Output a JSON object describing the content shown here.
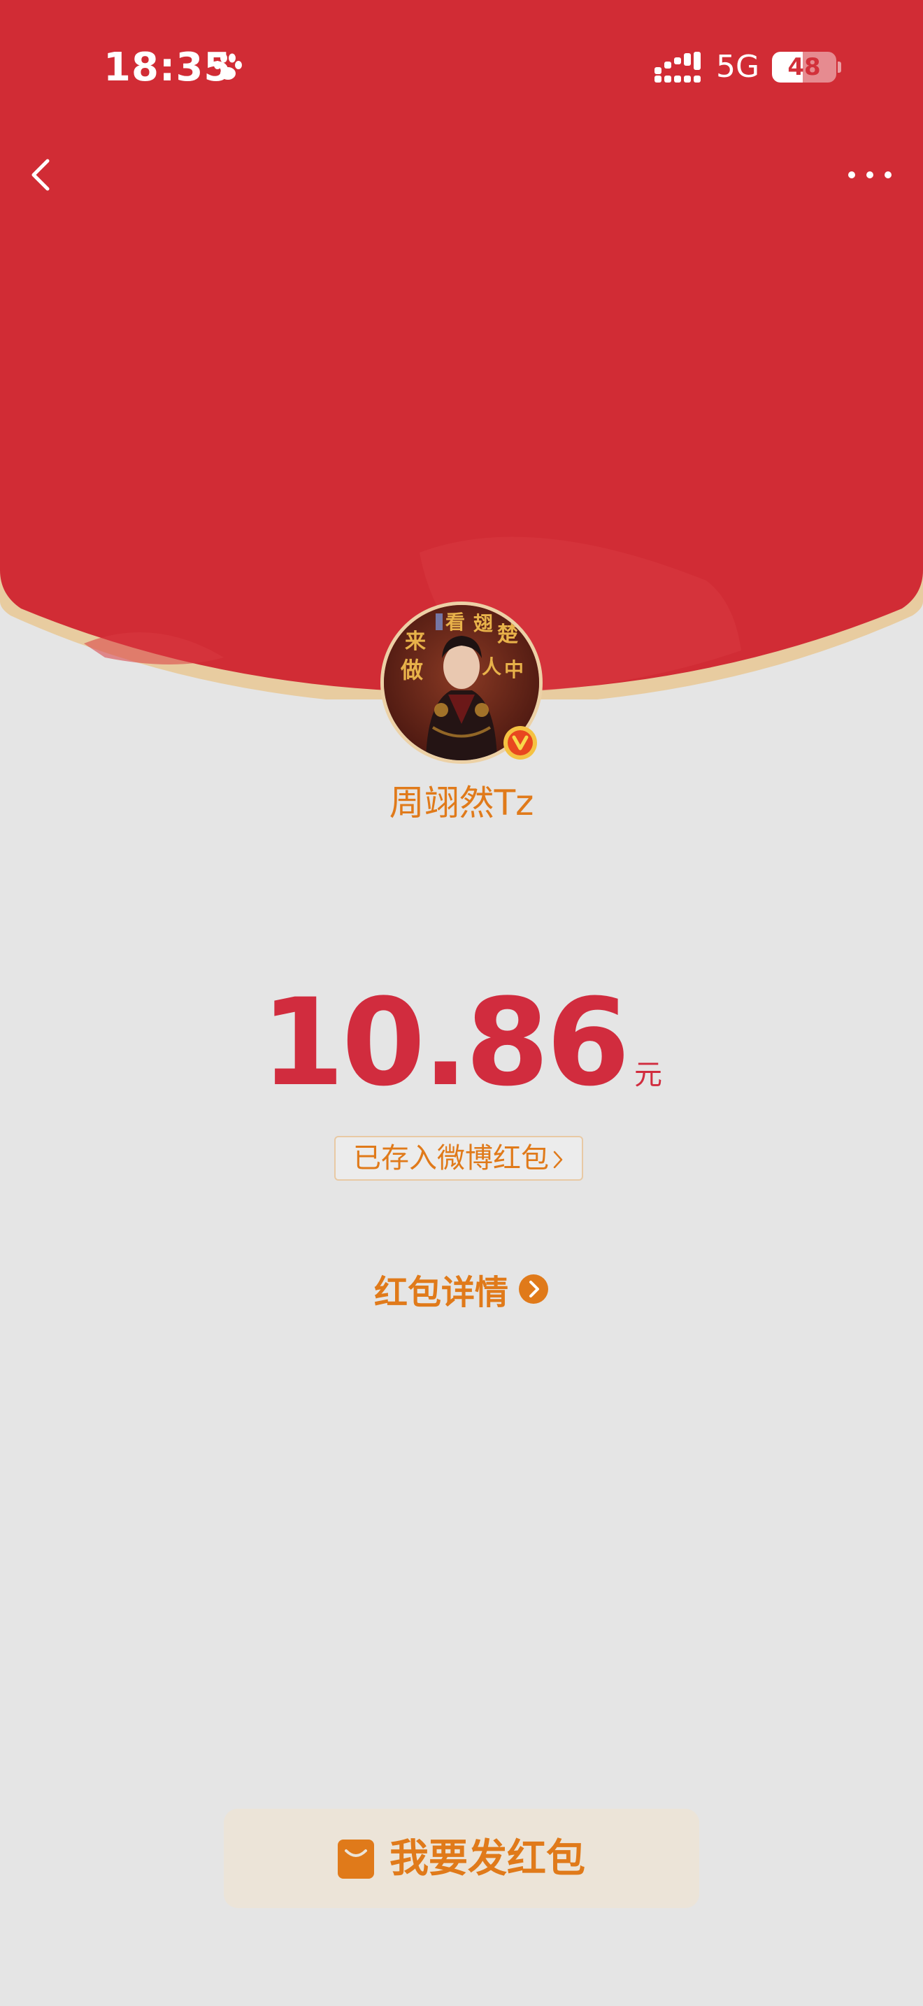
{
  "status_bar": {
    "time": "18:35",
    "network": "5G",
    "battery_level": "48",
    "battery_fraction": 0.48
  },
  "nav": {
    "back_icon": "chevron-left-icon",
    "more_icon": "more-horizontal-icon"
  },
  "sender": {
    "name": "周翊然Tz",
    "avatar_icon": "avatar-portrait",
    "avatar_text": [
      "来",
      "看",
      "翅",
      "楚",
      "做",
      "人",
      "中"
    ],
    "verified_icon": "verified-v-badge-icon"
  },
  "amount": {
    "value": "10.86",
    "unit": "元"
  },
  "saved_link": {
    "label": "已存入微博红包"
  },
  "details": {
    "label": "红包详情",
    "icon": "chevron-right-circle-icon"
  },
  "send_button": {
    "label": "我要发红包",
    "icon": "red-envelope-icon"
  },
  "colors": {
    "header_red": "#d12c35",
    "page_bg": "#e5e5e5",
    "accent_orange": "#e07a1a",
    "amount_red": "#d12c3e",
    "gold_rim": "#e8cca0",
    "button_bg": "#ece4d8"
  }
}
